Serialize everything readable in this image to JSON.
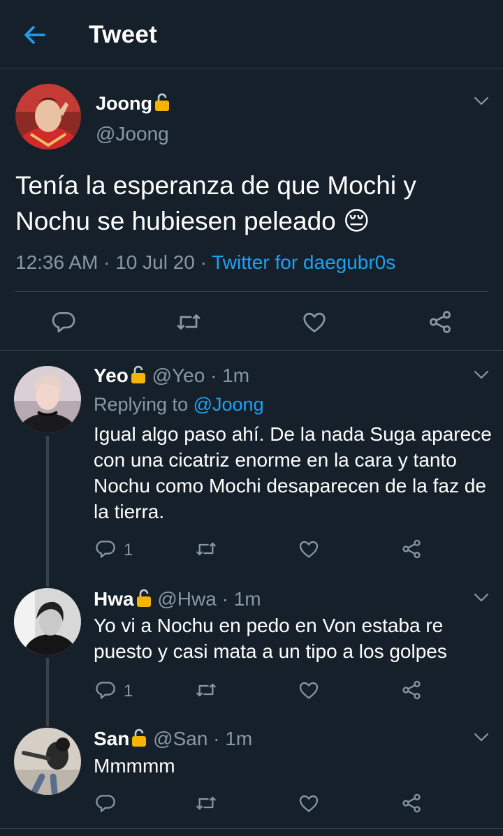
{
  "header": {
    "title": "Tweet"
  },
  "tweet": {
    "name": "Joong",
    "handle": "@Joong",
    "text": "Tenía la esperanza de que Mochi y Nochu se hubiesen peleado 😔",
    "time": "12:36 AM",
    "date": "10 Jul 20",
    "separator": "·",
    "source": "Twitter for daegubr0s"
  },
  "replies": [
    {
      "name": "Yeo",
      "handle": "@Yeo",
      "time": "1m",
      "separator": "·",
      "replying_label": "Replying to",
      "replying_to": "@Joong",
      "text": "Igual algo paso ahí. De la nada Suga aparece con una cicatriz enorme en la cara y tanto Nochu como Mochi desaparecen de la faz de la tierra.",
      "reply_count": "1"
    },
    {
      "name": "Hwa",
      "handle": "@Hwa",
      "time": "1m",
      "separator": "·",
      "text": "Yo vi a Nochu en pedo en Von estaba re puesto y casi mata a un tipo a los golpes",
      "reply_count": "1"
    },
    {
      "name": "San",
      "handle": "@San",
      "time": "1m",
      "separator": "·",
      "text": "Mmmmm"
    }
  ],
  "colors": {
    "background": "#15202b",
    "secondary_text": "#8899a6",
    "accent": "#1da1f2",
    "divider": "#38444d",
    "lock": "#f4b400"
  },
  "icons": [
    "back-arrow-icon",
    "lock-icon",
    "chevron-down-icon",
    "reply-icon",
    "retweet-icon",
    "like-icon",
    "share-icon"
  ]
}
